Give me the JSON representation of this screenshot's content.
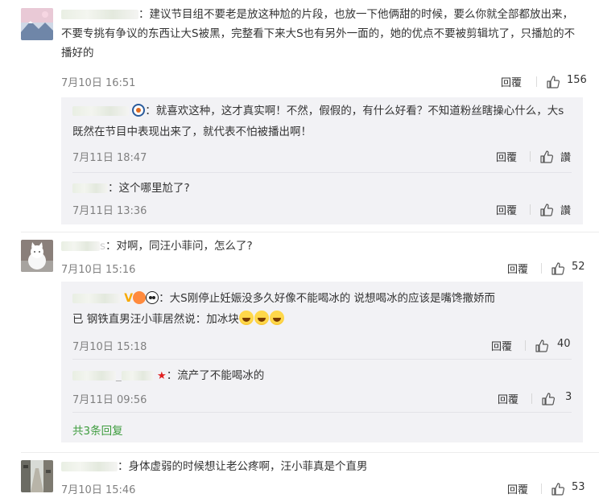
{
  "comments": [
    {
      "text": "：建议节目组不要老是放这种尬的片段，也放一下他俩甜的时候，要么你就全部都放出来，不要专挑有争议的东西让大S被黑，完整看下来大S也有另外一面的，她的优点不要被剪辑坑了，只播尬的不播好的",
      "time": "7月10日 16:51",
      "reply": "回覆",
      "likes": "156",
      "avatar_icon": "landscape-avatar-icon",
      "replies": [
        {
          "text": "：就喜欢这种，这才真实啊！不然，假假的，有什么好看？不知道粉丝瞎操心什么，大s既然在节目中表现出来了，就代表不怕被播出啊！",
          "time": "7月11日 18:47",
          "reply": "回覆",
          "likes": "讚"
        },
        {
          "text": "：这个哪里尬了?",
          "time": "7月11日 13:36",
          "reply": "回覆",
          "likes": "讚"
        }
      ]
    },
    {
      "name_suffix": "s",
      "text": "：对啊，同汪小菲问，怎么了?",
      "time": "7月10日 15:16",
      "reply": "回覆",
      "likes": "52",
      "avatar_icon": "white-cat-avatar-icon",
      "replies": [
        {
          "text_line1": "：大S刚停止妊娠没多久好像不能喝冰的 说想喝冰的应该是嘴馋撒娇而",
          "text_line2": "已 钢铁直男汪小菲居然说：加冰块",
          "time": "7月10日 15:18",
          "reply": "回覆",
          "likes": "40"
        },
        {
          "name_mid": "_",
          "text": "流产了不能喝冰的",
          "time": "7月11日 09:56",
          "reply": "回覆",
          "likes": "3"
        }
      ],
      "more_replies": "共3条回复"
    },
    {
      "text": "：身体虚弱的时候想让老公疼啊，汪小菲真是个直男",
      "time": "7月10日 15:46",
      "reply": "回覆",
      "likes": "53",
      "avatar_icon": "street-avatar-icon"
    }
  ],
  "colors": {
    "link_green": "#3e9c3e",
    "meta_gray": "#808080",
    "subbox_bg": "#f2f2f5"
  },
  "icons": {
    "like": "thumbs-up-icon"
  }
}
